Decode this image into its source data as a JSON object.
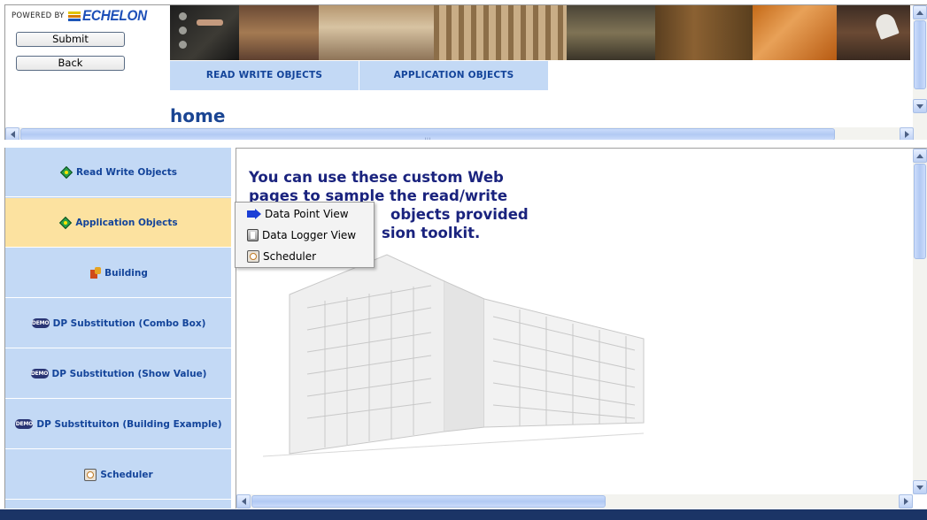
{
  "brand": {
    "powered_by": "POWERED BY",
    "logo_text": "ECHELON"
  },
  "form": {
    "submit_label": "Submit",
    "back_label": "Back"
  },
  "top_nav": {
    "tabs": [
      {
        "label": "READ WRITE OBJECTS"
      },
      {
        "label": "APPLICATION OBJECTS"
      }
    ]
  },
  "page": {
    "title": "home"
  },
  "sidebar": {
    "items": [
      {
        "label": "Read Write Objects",
        "icon": "green-diamond-icon",
        "active": false
      },
      {
        "label": "Application Objects",
        "icon": "green-diamond-icon",
        "active": true
      },
      {
        "label": "Building",
        "icon": "building-icon",
        "active": false
      },
      {
        "label": "DP Substitution (Combo Box)",
        "icon": "demo-badge-icon",
        "active": false
      },
      {
        "label": "DP Substitution (Show Value)",
        "icon": "demo-badge-icon",
        "active": false
      },
      {
        "label": "DP Substituiton (Building Example)",
        "icon": "demo-badge-icon",
        "active": false
      },
      {
        "label": "Scheduler",
        "icon": "clock-icon",
        "active": false
      }
    ]
  },
  "demo_badge_text": "DEMO",
  "content": {
    "intro_line1": "You can use these custom Web",
    "intro_line2": "pages to sample the read/write",
    "intro_line3": "objects provided",
    "intro_line4": "sion toolkit."
  },
  "context_menu": {
    "items": [
      {
        "label": "Data Point View",
        "icon": "blue-arrow-icon"
      },
      {
        "label": "Data Logger View",
        "icon": "data-logger-icon"
      },
      {
        "label": "Scheduler",
        "icon": "clock-icon"
      }
    ]
  },
  "colors": {
    "nav_bg": "#c3d9f5",
    "nav_active_bg": "#fce2a0",
    "nav_text": "#13449a",
    "heading_text": "#1a237e",
    "footer_bg": "#1b3466"
  }
}
